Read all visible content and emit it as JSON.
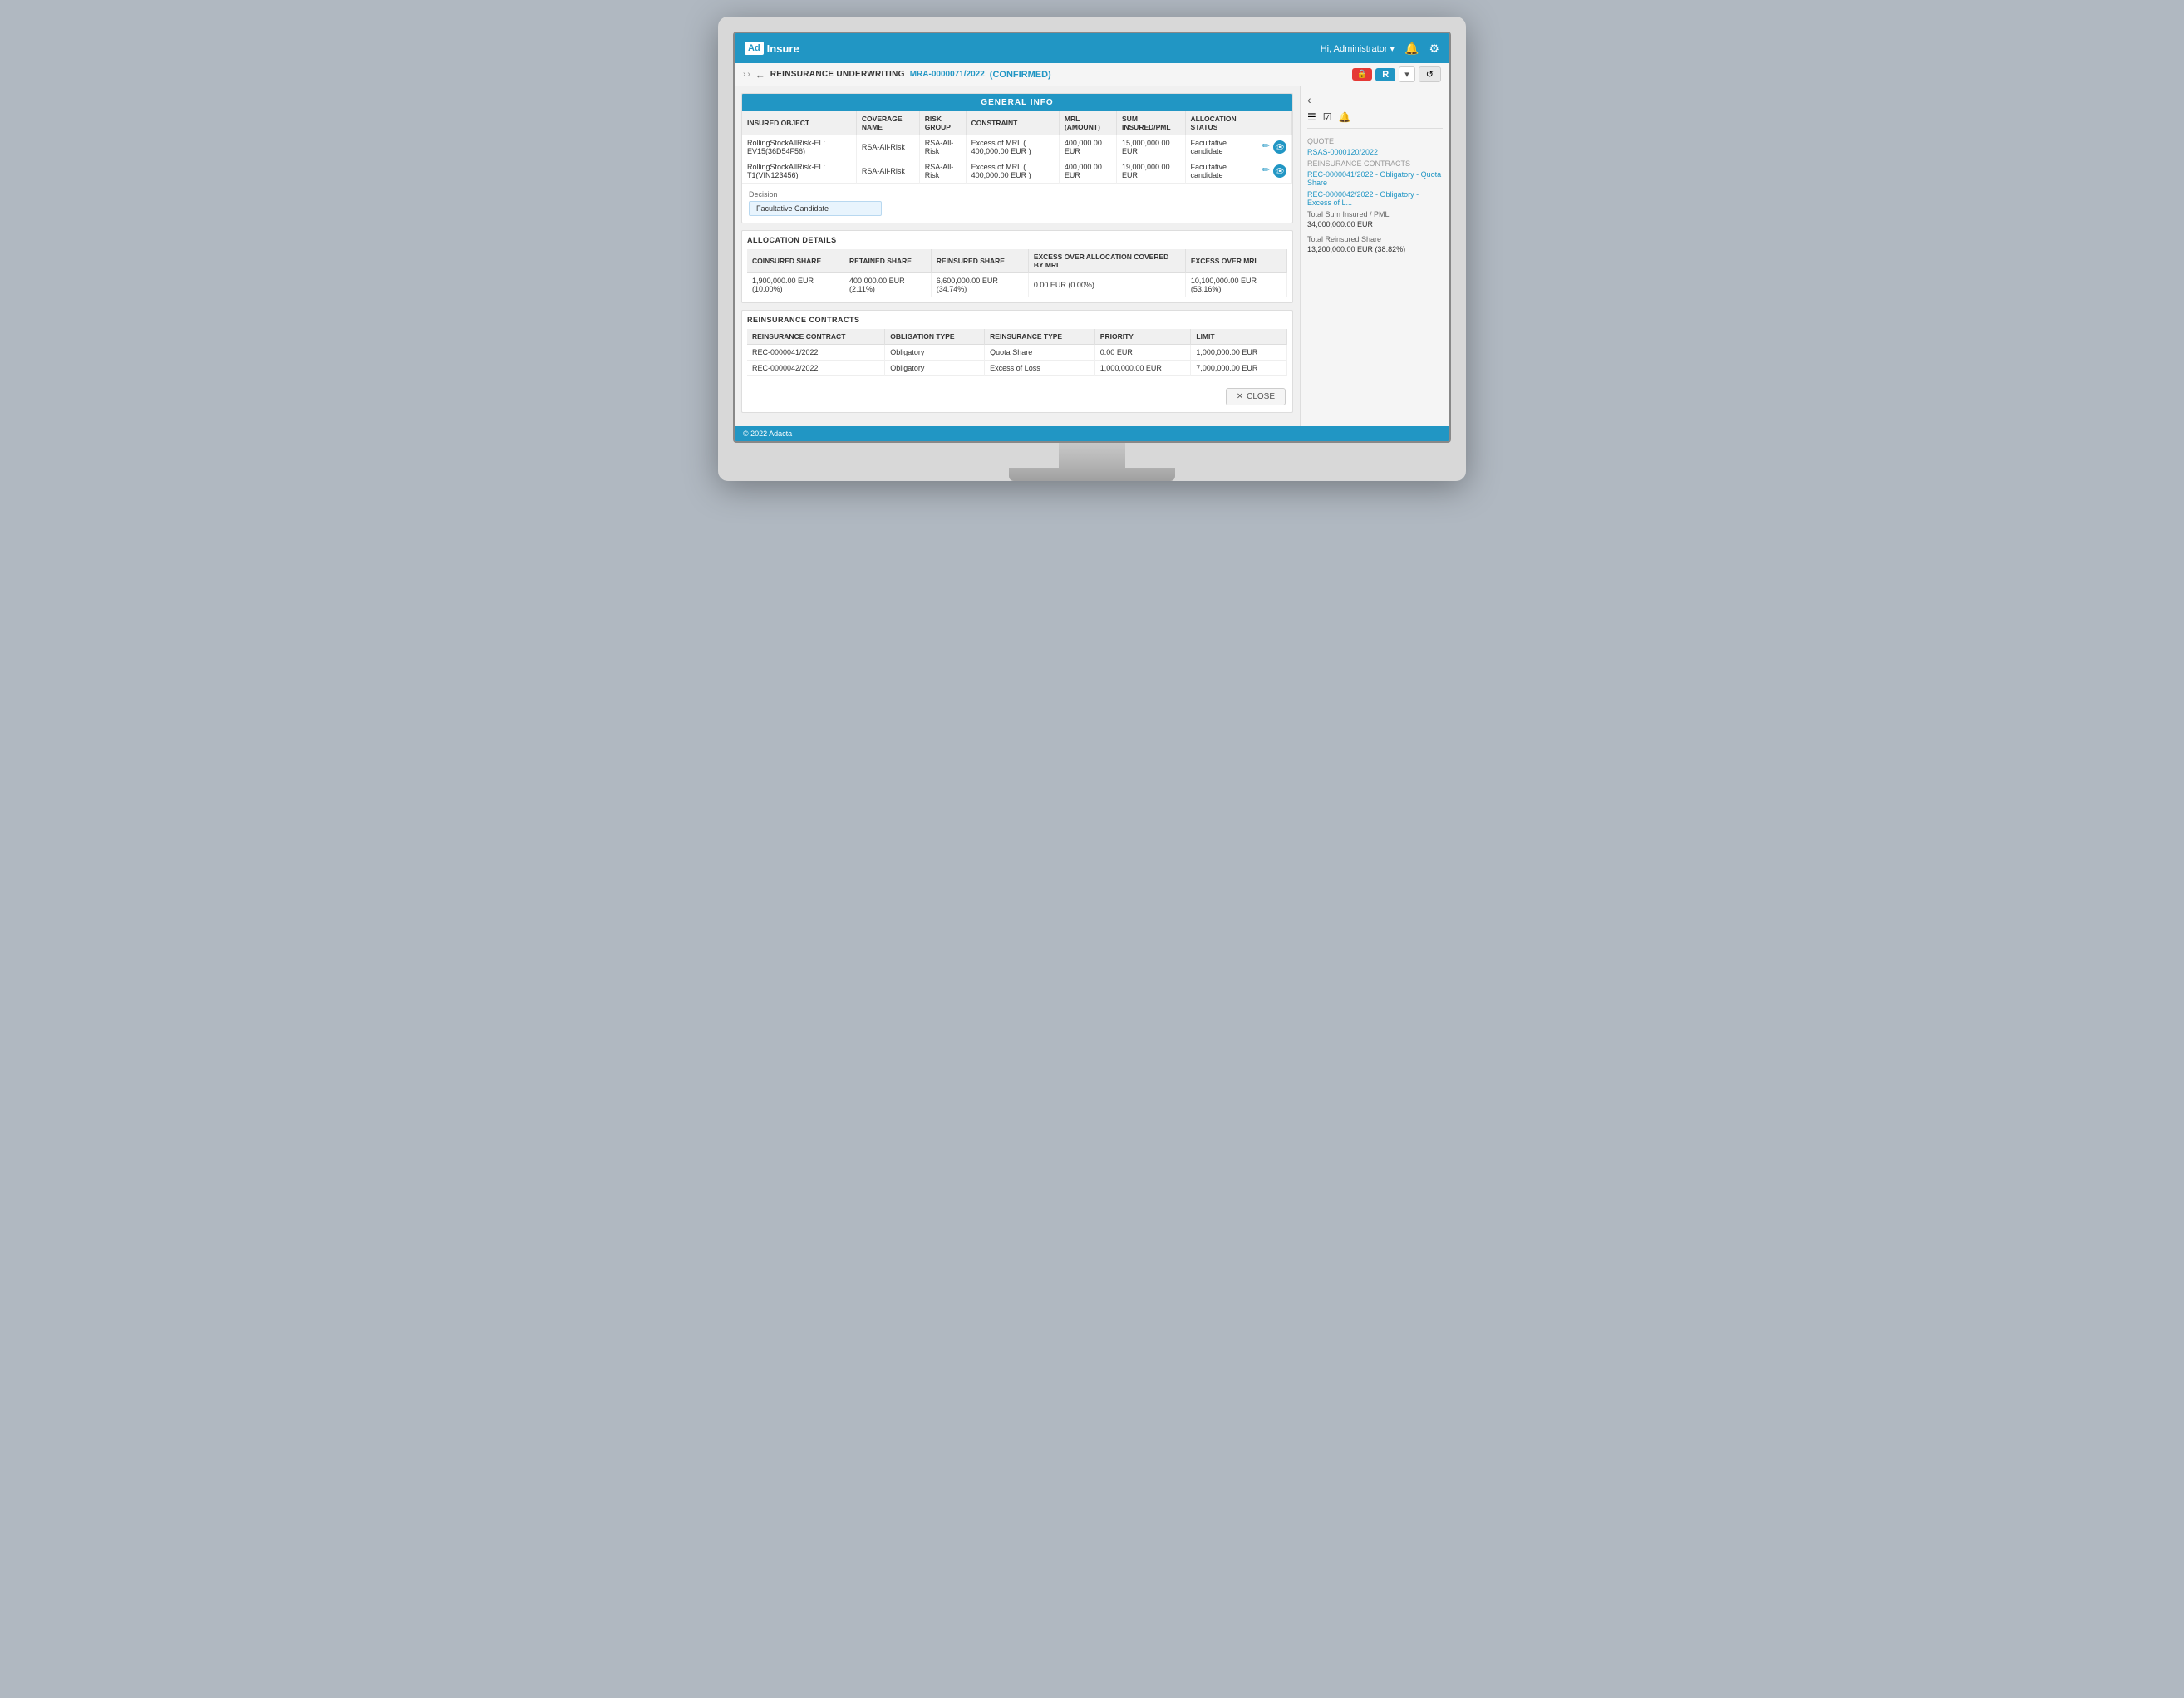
{
  "app": {
    "logo_ad": "Ad",
    "logo_insure": "Insure",
    "user_greeting": "Hi, Administrator",
    "footer_text": "© 2022 Adacta"
  },
  "breadcrumb": {
    "back_label": "REINSURANCE UNDERWRITING",
    "record_id": "MRA-0000071/2022",
    "status": "(CONFIRMED)"
  },
  "general_info": {
    "section_title": "GENERAL INFO",
    "table_headers": {
      "insured_object": "INSURED OBJECT",
      "coverage_name": "COVERAGE NAME",
      "risk_group": "RISK GROUP",
      "constraint": "CONSTRAINT",
      "mrl_amount": "MRL (AMOUNT)",
      "sum_insured": "SUM INSURED/PML",
      "allocation_status": "ALLOCATION STATUS"
    },
    "rows": [
      {
        "insured_object": "RollingStockAllRisk-EL: EV15(36D54F56)",
        "coverage_name": "RSA-All-Risk",
        "risk_group": "RSA-All-Risk",
        "constraint": "Excess of MRL ( 400,000.00 EUR )",
        "mrl_amount": "400,000.00 EUR",
        "sum_insured": "15,000,000.00 EUR",
        "allocation_status": "Facultative candidate"
      },
      {
        "insured_object": "RollingStockAllRisk-EL: T1(VIN123456)",
        "coverage_name": "RSA-All-Risk",
        "risk_group": "RSA-All-Risk",
        "constraint": "Excess of MRL ( 400,000.00 EUR )",
        "mrl_amount": "400,000.00 EUR",
        "sum_insured": "19,000,000.00 EUR",
        "allocation_status": "Facultative candidate"
      }
    ]
  },
  "decision": {
    "label": "Decision",
    "value": "Facultative Candidate"
  },
  "allocation_details": {
    "section_title": "ALLOCATION DETAILS",
    "table_headers": {
      "coinsured_share": "COINSURED SHARE",
      "retained_share": "RETAINED SHARE",
      "reinsured_share": "REINSURED SHARE",
      "excess_over_allocation": "EXCESS OVER ALLOCATION COVERED BY MRL",
      "excess_over_mrl": "EXCESS OVER MRL"
    },
    "rows": [
      {
        "coinsured_share": "1,900,000.00 EUR (10.00%)",
        "retained_share": "400,000.00 EUR (2.11%)",
        "reinsured_share": "6,600,000.00 EUR (34.74%)",
        "excess_over_allocation": "0.00 EUR (0.00%)",
        "excess_over_mrl": "10,100,000.00 EUR (53.16%)"
      }
    ]
  },
  "reinsurance_contracts": {
    "section_title": "REINSURANCE CONTRACTS",
    "table_headers": {
      "contract": "REINSURANCE CONTRACT",
      "obligation_type": "OBLIGATION TYPE",
      "reinsurance_type": "REINSURANCE TYPE",
      "priority": "PRIORITY",
      "limit": "LIMIT"
    },
    "rows": [
      {
        "contract": "REC-0000041/2022",
        "obligation_type": "Obligatory",
        "reinsurance_type": "Quota Share",
        "priority": "0.00 EUR",
        "limit": "1,000,000.00 EUR"
      },
      {
        "contract": "REC-0000042/2022",
        "obligation_type": "Obligatory",
        "reinsurance_type": "Excess of Loss",
        "priority": "1,000,000.00 EUR",
        "limit": "7,000,000.00 EUR"
      }
    ]
  },
  "close_button": {
    "label": "CLOSE"
  },
  "sidebar": {
    "quote_label": "Quote",
    "quote_link": "RSAS-0000120/2022",
    "contracts_label": "REINSURANCE CONTRACTS",
    "contract1_link": "REC-0000041/2022 - Obligatory - Quota Share",
    "contract2_link": "REC-0000042/2022 - Obligatory - Excess of L...",
    "total_sum_label": "Total Sum Insured / PML",
    "total_sum_value": "34,000,000.00 EUR",
    "total_reinsured_label": "Total Reinsured Share",
    "total_reinsured_value": "13,200,000.00 EUR (38.82%)"
  }
}
